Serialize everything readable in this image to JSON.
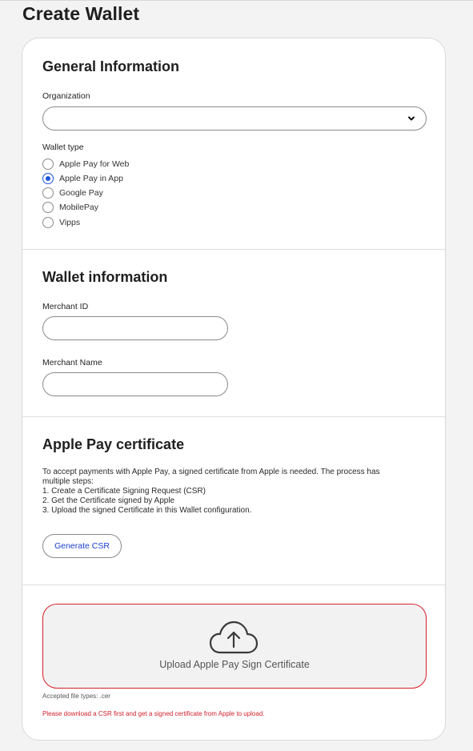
{
  "page": {
    "title": "Create Wallet"
  },
  "general": {
    "heading": "General Information",
    "organization_label": "Organization",
    "organization_value": "",
    "wallet_type_label": "Wallet type",
    "wallet_types": [
      {
        "label": "Apple Pay for Web",
        "checked": false
      },
      {
        "label": "Apple Pay in App",
        "checked": true
      },
      {
        "label": "Google Pay",
        "checked": false
      },
      {
        "label": "MobilePay",
        "checked": false
      },
      {
        "label": "Vipps",
        "checked": false
      }
    ]
  },
  "wallet_info": {
    "heading": "Wallet information",
    "merchant_id_label": "Merchant ID",
    "merchant_id_value": "",
    "merchant_name_label": "Merchant Name",
    "merchant_name_value": ""
  },
  "certificate": {
    "heading": "Apple Pay certificate",
    "intro_line1": "To accept payments with Apple Pay, a signed certificate from Apple is needed. The process has",
    "intro_line2": "multiple steps:",
    "step1": "1. Create a Certificate Signing Request (CSR)",
    "step2": "2. Get the Certificate signed by Apple",
    "step3": "3. Upload the signed Certificate in this Wallet configuration.",
    "generate_button": "Generate CSR"
  },
  "upload": {
    "label": "Upload Apple Pay Sign Certificate",
    "accepted": "Accepted file types: .cer",
    "error": "Please download a CSR first and get a signed certificate from Apple to upload.",
    "error_color": "#d11f2a",
    "icon": "cloud-upload-icon"
  },
  "colors": {
    "accent": "#1a56db",
    "link": "#1a3fcf",
    "error_border": "#d6202a"
  }
}
